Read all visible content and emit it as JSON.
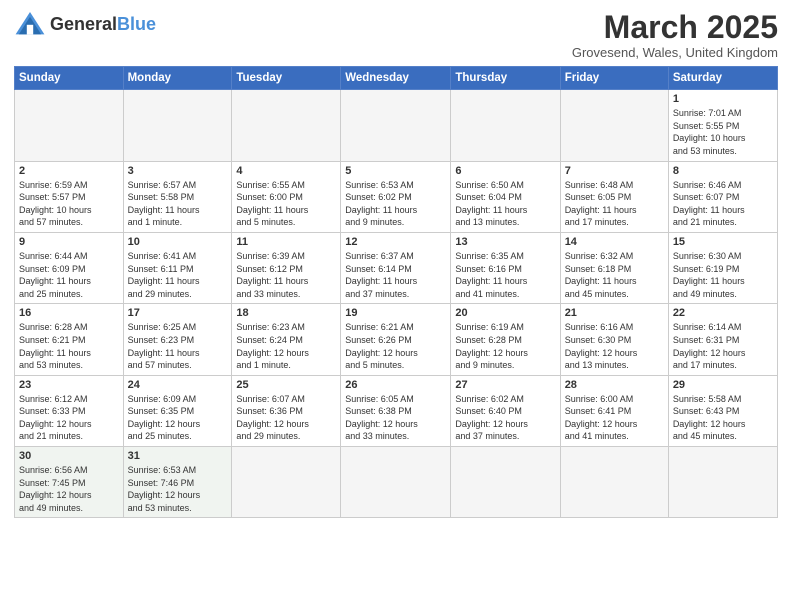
{
  "logo": {
    "text_general": "General",
    "text_blue": "Blue"
  },
  "header": {
    "month": "March 2025",
    "location": "Grovesend, Wales, United Kingdom"
  },
  "days_of_week": [
    "Sunday",
    "Monday",
    "Tuesday",
    "Wednesday",
    "Thursday",
    "Friday",
    "Saturday"
  ],
  "weeks": [
    [
      {
        "day": "",
        "info": "",
        "empty": true
      },
      {
        "day": "",
        "info": "",
        "empty": true
      },
      {
        "day": "",
        "info": "",
        "empty": true
      },
      {
        "day": "",
        "info": "",
        "empty": true
      },
      {
        "day": "",
        "info": "",
        "empty": true
      },
      {
        "day": "",
        "info": "",
        "empty": true
      },
      {
        "day": "1",
        "info": "Sunrise: 7:01 AM\nSunset: 5:55 PM\nDaylight: 10 hours\nand 53 minutes."
      }
    ],
    [
      {
        "day": "2",
        "info": "Sunrise: 6:59 AM\nSunset: 5:57 PM\nDaylight: 10 hours\nand 57 minutes."
      },
      {
        "day": "3",
        "info": "Sunrise: 6:57 AM\nSunset: 5:58 PM\nDaylight: 11 hours\nand 1 minute."
      },
      {
        "day": "4",
        "info": "Sunrise: 6:55 AM\nSunset: 6:00 PM\nDaylight: 11 hours\nand 5 minutes."
      },
      {
        "day": "5",
        "info": "Sunrise: 6:53 AM\nSunset: 6:02 PM\nDaylight: 11 hours\nand 9 minutes."
      },
      {
        "day": "6",
        "info": "Sunrise: 6:50 AM\nSunset: 6:04 PM\nDaylight: 11 hours\nand 13 minutes."
      },
      {
        "day": "7",
        "info": "Sunrise: 6:48 AM\nSunset: 6:05 PM\nDaylight: 11 hours\nand 17 minutes."
      },
      {
        "day": "8",
        "info": "Sunrise: 6:46 AM\nSunset: 6:07 PM\nDaylight: 11 hours\nand 21 minutes."
      }
    ],
    [
      {
        "day": "9",
        "info": "Sunrise: 6:44 AM\nSunset: 6:09 PM\nDaylight: 11 hours\nand 25 minutes."
      },
      {
        "day": "10",
        "info": "Sunrise: 6:41 AM\nSunset: 6:11 PM\nDaylight: 11 hours\nand 29 minutes."
      },
      {
        "day": "11",
        "info": "Sunrise: 6:39 AM\nSunset: 6:12 PM\nDaylight: 11 hours\nand 33 minutes."
      },
      {
        "day": "12",
        "info": "Sunrise: 6:37 AM\nSunset: 6:14 PM\nDaylight: 11 hours\nand 37 minutes."
      },
      {
        "day": "13",
        "info": "Sunrise: 6:35 AM\nSunset: 6:16 PM\nDaylight: 11 hours\nand 41 minutes."
      },
      {
        "day": "14",
        "info": "Sunrise: 6:32 AM\nSunset: 6:18 PM\nDaylight: 11 hours\nand 45 minutes."
      },
      {
        "day": "15",
        "info": "Sunrise: 6:30 AM\nSunset: 6:19 PM\nDaylight: 11 hours\nand 49 minutes."
      }
    ],
    [
      {
        "day": "16",
        "info": "Sunrise: 6:28 AM\nSunset: 6:21 PM\nDaylight: 11 hours\nand 53 minutes."
      },
      {
        "day": "17",
        "info": "Sunrise: 6:25 AM\nSunset: 6:23 PM\nDaylight: 11 hours\nand 57 minutes."
      },
      {
        "day": "18",
        "info": "Sunrise: 6:23 AM\nSunset: 6:24 PM\nDaylight: 12 hours\nand 1 minute."
      },
      {
        "day": "19",
        "info": "Sunrise: 6:21 AM\nSunset: 6:26 PM\nDaylight: 12 hours\nand 5 minutes."
      },
      {
        "day": "20",
        "info": "Sunrise: 6:19 AM\nSunset: 6:28 PM\nDaylight: 12 hours\nand 9 minutes."
      },
      {
        "day": "21",
        "info": "Sunrise: 6:16 AM\nSunset: 6:30 PM\nDaylight: 12 hours\nand 13 minutes."
      },
      {
        "day": "22",
        "info": "Sunrise: 6:14 AM\nSunset: 6:31 PM\nDaylight: 12 hours\nand 17 minutes."
      }
    ],
    [
      {
        "day": "23",
        "info": "Sunrise: 6:12 AM\nSunset: 6:33 PM\nDaylight: 12 hours\nand 21 minutes."
      },
      {
        "day": "24",
        "info": "Sunrise: 6:09 AM\nSunset: 6:35 PM\nDaylight: 12 hours\nand 25 minutes."
      },
      {
        "day": "25",
        "info": "Sunrise: 6:07 AM\nSunset: 6:36 PM\nDaylight: 12 hours\nand 29 minutes."
      },
      {
        "day": "26",
        "info": "Sunrise: 6:05 AM\nSunset: 6:38 PM\nDaylight: 12 hours\nand 33 minutes."
      },
      {
        "day": "27",
        "info": "Sunrise: 6:02 AM\nSunset: 6:40 PM\nDaylight: 12 hours\nand 37 minutes."
      },
      {
        "day": "28",
        "info": "Sunrise: 6:00 AM\nSunset: 6:41 PM\nDaylight: 12 hours\nand 41 minutes."
      },
      {
        "day": "29",
        "info": "Sunrise: 5:58 AM\nSunset: 6:43 PM\nDaylight: 12 hours\nand 45 minutes."
      }
    ],
    [
      {
        "day": "30",
        "info": "Sunrise: 6:56 AM\nSunset: 7:45 PM\nDaylight: 12 hours\nand 49 minutes."
      },
      {
        "day": "31",
        "info": "Sunrise: 6:53 AM\nSunset: 7:46 PM\nDaylight: 12 hours\nand 53 minutes."
      },
      {
        "day": "",
        "info": "",
        "empty": true
      },
      {
        "day": "",
        "info": "",
        "empty": true
      },
      {
        "day": "",
        "info": "",
        "empty": true
      },
      {
        "day": "",
        "info": "",
        "empty": true
      },
      {
        "day": "",
        "info": "",
        "empty": true
      }
    ]
  ]
}
